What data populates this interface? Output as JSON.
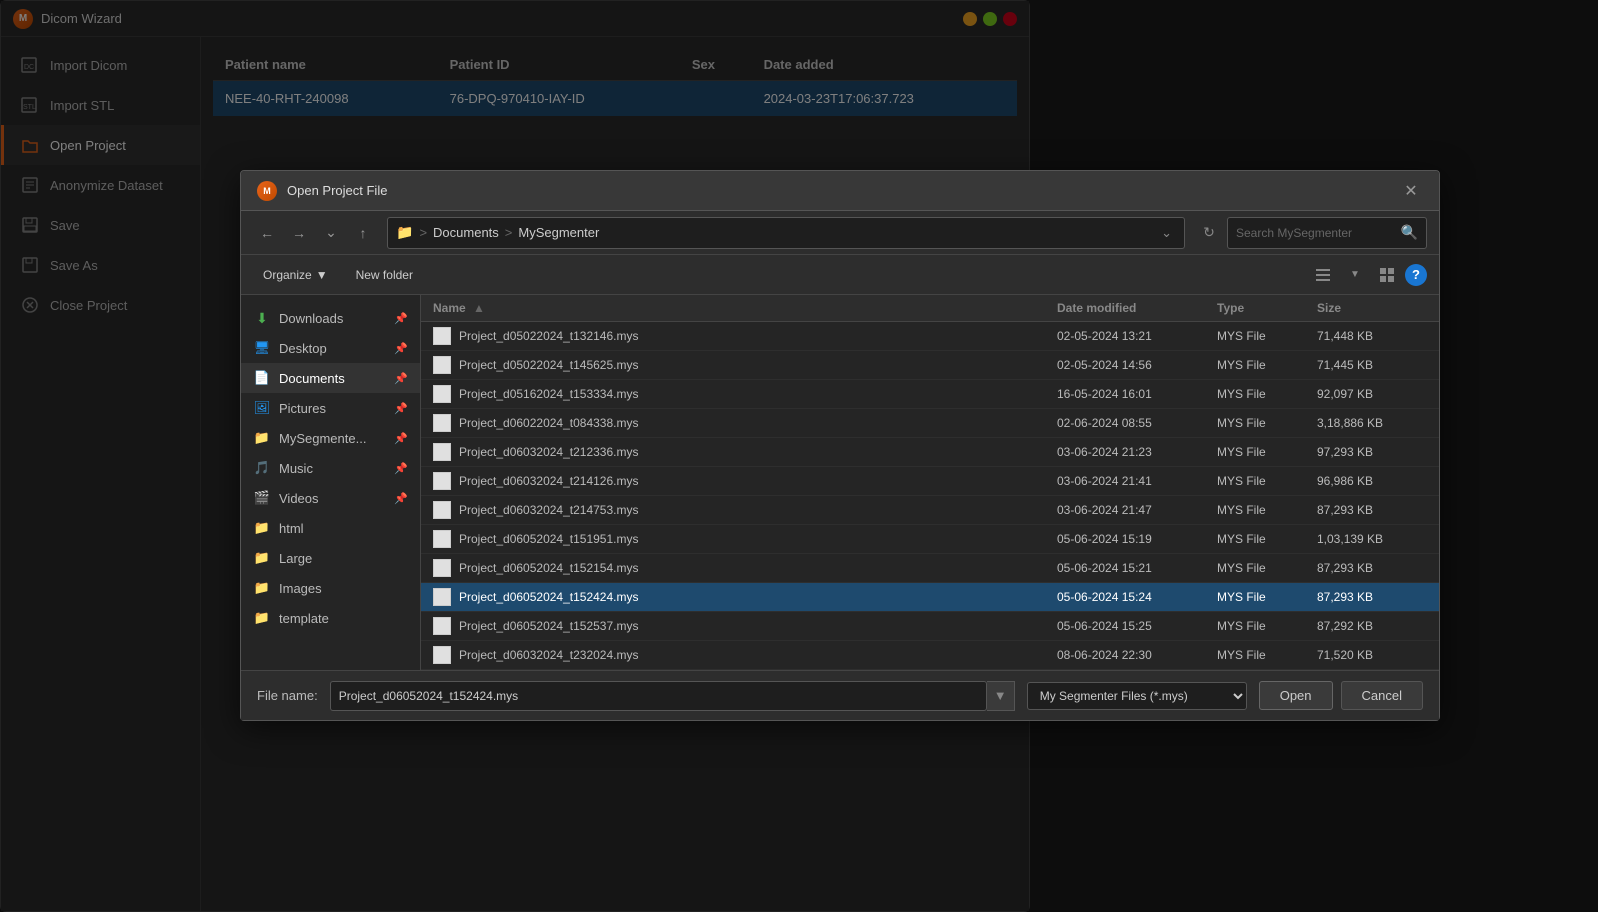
{
  "app": {
    "title": "Dicom Wizard",
    "logo": "M"
  },
  "sidebar": {
    "items": [
      {
        "id": "import-dicom",
        "label": "Import Dicom",
        "icon": "dicom"
      },
      {
        "id": "import-stl",
        "label": "Import STL",
        "icon": "stl"
      },
      {
        "id": "open-project",
        "label": "Open Project",
        "icon": "folder",
        "active": true
      },
      {
        "id": "anonymize",
        "label": "Anonymize Dataset",
        "icon": "anonymize"
      },
      {
        "id": "save",
        "label": "Save",
        "icon": "save"
      },
      {
        "id": "save-as",
        "label": "Save As",
        "icon": "saveas"
      },
      {
        "id": "close-project",
        "label": "Close Project",
        "icon": "close"
      }
    ]
  },
  "patient_table": {
    "columns": [
      "Patient name",
      "Patient ID",
      "Sex",
      "Date added"
    ],
    "rows": [
      {
        "name": "NEE-40-RHT-240098",
        "id": "76-DPQ-970410-IAY-ID",
        "sex": "",
        "date": "2024-03-23T17:06:37.723",
        "selected": true
      }
    ]
  },
  "dialog": {
    "title": "Open Project File",
    "logo": "M",
    "close_btn": "✕",
    "path": {
      "folder_icon": "📁",
      "breadcrumb": [
        "Documents",
        "MySegmenter"
      ],
      "separator": ">",
      "placeholder": "Search MySegmenter"
    },
    "toolbar": {
      "organize_label": "Organize",
      "new_folder_label": "New folder"
    },
    "sidebar": {
      "items": [
        {
          "id": "downloads",
          "label": "Downloads",
          "icon": "⬇",
          "color": "#4caf50",
          "pinned": true
        },
        {
          "id": "desktop",
          "label": "Desktop",
          "icon": "🖥",
          "color": "#2196f3",
          "pinned": true
        },
        {
          "id": "documents",
          "label": "Documents",
          "icon": "📄",
          "color": "#9c27b0",
          "pinned": true,
          "active": true
        },
        {
          "id": "pictures",
          "label": "Pictures",
          "icon": "🖼",
          "color": "#2196f3",
          "pinned": true
        },
        {
          "id": "mysegmenter",
          "label": "MySegmente...",
          "icon": "📁",
          "color": "#f0c040",
          "pinned": true
        },
        {
          "id": "music",
          "label": "Music",
          "icon": "🎵",
          "color": "#e8641a",
          "pinned": true
        },
        {
          "id": "videos",
          "label": "Videos",
          "icon": "🎬",
          "color": "#9c27b0",
          "pinned": true
        },
        {
          "id": "html",
          "label": "html",
          "icon": "📁",
          "color": "#f0c040",
          "pinned": false
        },
        {
          "id": "large",
          "label": "Large",
          "icon": "📁",
          "color": "#f0c040",
          "pinned": false
        },
        {
          "id": "images",
          "label": "Images",
          "icon": "📁",
          "color": "#f0c040",
          "pinned": false
        },
        {
          "id": "template",
          "label": "template",
          "icon": "📁",
          "color": "#f0c040",
          "pinned": false
        }
      ]
    },
    "filelist": {
      "columns": [
        {
          "id": "name",
          "label": "Name",
          "sort": "asc"
        },
        {
          "id": "date",
          "label": "Date modified"
        },
        {
          "id": "type",
          "label": "Type"
        },
        {
          "id": "size",
          "label": "Size"
        }
      ],
      "files": [
        {
          "name": "Project_d05022024_t132146.mys",
          "date": "02-05-2024 13:21",
          "type": "MYS File",
          "size": "71,448 KB",
          "selected": false
        },
        {
          "name": "Project_d05022024_t145625.mys",
          "date": "02-05-2024 14:56",
          "type": "MYS File",
          "size": "71,445 KB",
          "selected": false
        },
        {
          "name": "Project_d05162024_t153334.mys",
          "date": "16-05-2024 16:01",
          "type": "MYS File",
          "size": "92,097 KB",
          "selected": false
        },
        {
          "name": "Project_d06022024_t084338.mys",
          "date": "02-06-2024 08:55",
          "type": "MYS File",
          "size": "3,18,886 KB",
          "selected": false
        },
        {
          "name": "Project_d06032024_t212336.mys",
          "date": "03-06-2024 21:23",
          "type": "MYS File",
          "size": "97,293 KB",
          "selected": false
        },
        {
          "name": "Project_d06032024_t214126.mys",
          "date": "03-06-2024 21:41",
          "type": "MYS File",
          "size": "96,986 KB",
          "selected": false
        },
        {
          "name": "Project_d06032024_t214753.mys",
          "date": "03-06-2024 21:47",
          "type": "MYS File",
          "size": "87,293 KB",
          "selected": false
        },
        {
          "name": "Project_d06052024_t151951.mys",
          "date": "05-06-2024 15:19",
          "type": "MYS File",
          "size": "1,03,139 KB",
          "selected": false
        },
        {
          "name": "Project_d06052024_t152154.mys",
          "date": "05-06-2024 15:21",
          "type": "MYS File",
          "size": "87,293 KB",
          "selected": false
        },
        {
          "name": "Project_d06052024_t152424.mys",
          "date": "05-06-2024 15:24",
          "type": "MYS File",
          "size": "87,293 KB",
          "selected": true
        },
        {
          "name": "Project_d06052024_t152537.mys",
          "date": "05-06-2024 15:25",
          "type": "MYS File",
          "size": "87,292 KB",
          "selected": false
        },
        {
          "name": "Project_d06032024_t232024.mys",
          "date": "08-06-2024 22:30",
          "type": "MYS File",
          "size": "71,520 KB",
          "selected": false
        }
      ]
    },
    "footer": {
      "filename_label": "File name:",
      "filename_value": "Project_d06052024_t152424.mys",
      "filetype_label": "My Segmenter Files (*.mys)",
      "open_btn": "Open",
      "cancel_btn": "Cancel"
    }
  }
}
